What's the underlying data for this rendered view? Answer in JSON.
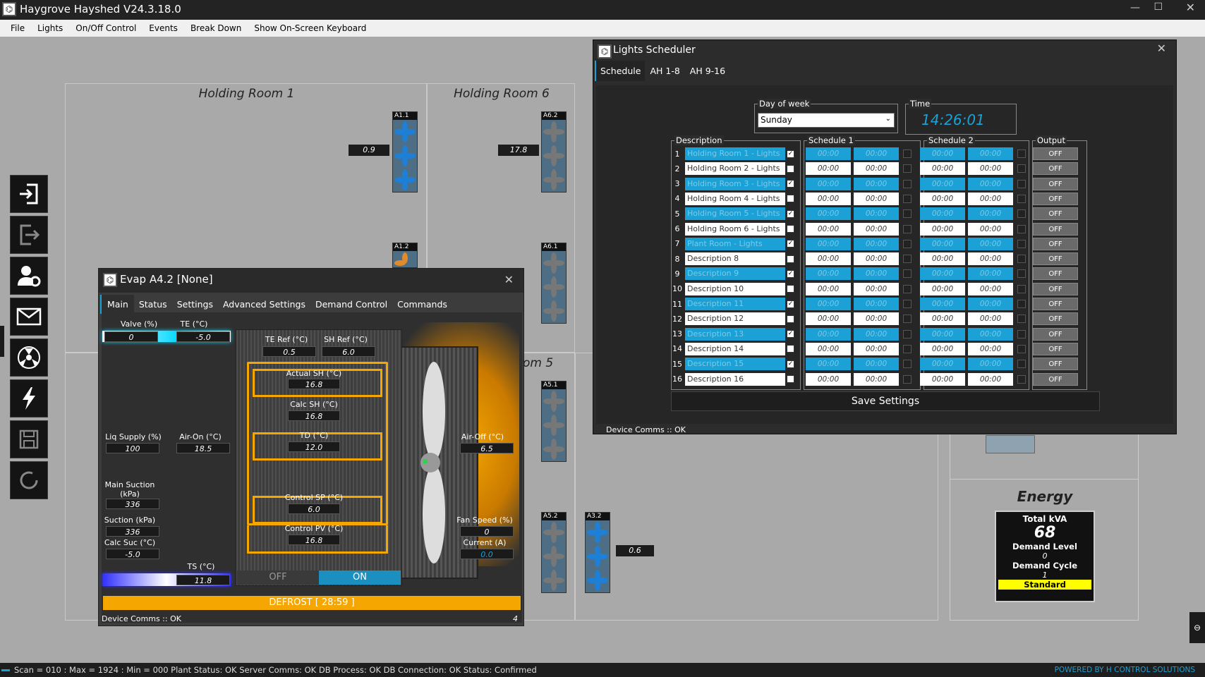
{
  "app": {
    "title": "Haygrove Hayshed V24.3.18.0"
  },
  "menu": [
    "File",
    "Lights",
    "On/Off Control",
    "Events",
    "Break Down",
    "Show On-Screen Keyboard"
  ],
  "rooms": {
    "room1": {
      "title": "Holding Room 1",
      "value": "0.9",
      "fan_top": "A1.1",
      "fan_bottom": "A1.2"
    },
    "room6": {
      "title": "Holding Room 6",
      "value": "17.8",
      "fan_top": "A6.2",
      "fan_bottom": "A6.1"
    },
    "room5": {
      "title_partial": "om 5",
      "fan_a": "A5.1",
      "fan_b": "A5.2",
      "fan_c": "A3.2",
      "value": "0.6"
    }
  },
  "energy": {
    "title": "Energy",
    "total_label": "Total kVA",
    "total_value": "68",
    "demand_level_label": "Demand Level",
    "demand_level_value": "0",
    "demand_cycle_label": "Demand Cycle",
    "demand_cycle_value": "1",
    "mode": "Standard"
  },
  "evap": {
    "title": "Evap A4.2 [None]",
    "tabs": [
      "Main",
      "Status",
      "Settings",
      "Advanced Settings",
      "Demand Control",
      "Commands"
    ],
    "valve_label": "Valve (%)",
    "valve": "0",
    "te_label": "TE (°C)",
    "te": "-5.0",
    "te_ref_label": "TE Ref (°C)",
    "te_ref": "0.5",
    "sh_ref_label": "SH Ref (°C)",
    "sh_ref": "6.0",
    "actual_sh_label": "Actual SH (°C)",
    "actual_sh": "16.8",
    "calc_sh_label": "Calc SH (°C)",
    "calc_sh": "16.8",
    "td_label": "TD (°C)",
    "td": "12.0",
    "control_sp_label": "Control SP (°C)",
    "control_sp": "6.0",
    "control_pv_label": "Control PV (°C)",
    "control_pv": "16.8",
    "liq_supply_label": "Liq Supply (%)",
    "liq_supply": "100",
    "air_on_label": "Air-On (°C)",
    "air_on": "18.5",
    "air_off_label": "Air-Off (°C)",
    "air_off": "6.5",
    "main_suction_label": "Main Suction (kPa)",
    "main_suction": "336",
    "suction_label": "Suction (kPa)",
    "suction": "336",
    "calc_suc_label": "Calc Suc (°C)",
    "calc_suc": "-5.0",
    "ts_label": "TS (°C)",
    "ts": "11.8",
    "fan_speed_label": "Fan Speed (%)",
    "fan_speed": "0",
    "current_label": "Current (A)",
    "current": "0.0",
    "off_label": "OFF",
    "on_label": "ON",
    "defrost": "DEFROST [ 28:59 ]",
    "comms": "Device Comms :: OK",
    "page": "4"
  },
  "lights": {
    "title": "Lights Scheduler",
    "tabs": [
      "Schedule",
      "AH 1-8",
      "AH 9-16"
    ],
    "day_label": "Day of week",
    "day": "Sunday",
    "time_label": "Time",
    "time": "14:26:01",
    "desc_header": "Description",
    "sched1_header": "Schedule 1",
    "sched2_header": "Schedule 2",
    "output_header": "Output",
    "rows": [
      {
        "n": "1",
        "d": "Holding Room 1 - Lights",
        "en": true,
        "s1a": "00:00",
        "s1b": "00:00",
        "s2a": "00:00",
        "s2b": "00:00",
        "out": "OFF"
      },
      {
        "n": "2",
        "d": "Holding Room 2 - Lights",
        "en": false,
        "s1a": "00:00",
        "s1b": "00:00",
        "s2a": "00:00",
        "s2b": "00:00",
        "out": "OFF"
      },
      {
        "n": "3",
        "d": "Holding Room 3 - Lights",
        "en": true,
        "s1a": "00:00",
        "s1b": "00:00",
        "s2a": "00:00",
        "s2b": "00:00",
        "out": "OFF"
      },
      {
        "n": "4",
        "d": "Holding Room 4 - Lights",
        "en": false,
        "s1a": "00:00",
        "s1b": "00:00",
        "s2a": "00:00",
        "s2b": "00:00",
        "out": "OFF"
      },
      {
        "n": "5",
        "d": "Holding Room 5 - Lights",
        "en": true,
        "s1a": "00:00",
        "s1b": "00:00",
        "s2a": "00:00",
        "s2b": "00:00",
        "out": "OFF"
      },
      {
        "n": "6",
        "d": "Holding Room 6 - Lights",
        "en": false,
        "s1a": "00:00",
        "s1b": "00:00",
        "s2a": "00:00",
        "s2b": "00:00",
        "out": "OFF"
      },
      {
        "n": "7",
        "d": "Plant Room - Lights",
        "en": true,
        "s1a": "00:00",
        "s1b": "00:00",
        "s2a": "00:00",
        "s2b": "00:00",
        "out": "OFF"
      },
      {
        "n": "8",
        "d": "Description 8",
        "en": false,
        "s1a": "00:00",
        "s1b": "00:00",
        "s2a": "00:00",
        "s2b": "00:00",
        "out": "OFF"
      },
      {
        "n": "9",
        "d": "Description 9",
        "en": true,
        "s1a": "00:00",
        "s1b": "00:00",
        "s2a": "00:00",
        "s2b": "00:00",
        "out": "OFF"
      },
      {
        "n": "10",
        "d": "Description 10",
        "en": false,
        "s1a": "00:00",
        "s1b": "00:00",
        "s2a": "00:00",
        "s2b": "00:00",
        "out": "OFF"
      },
      {
        "n": "11",
        "d": "Description 11",
        "en": true,
        "s1a": "00:00",
        "s1b": "00:00",
        "s2a": "00:00",
        "s2b": "00:00",
        "out": "OFF"
      },
      {
        "n": "12",
        "d": "Description 12",
        "en": false,
        "s1a": "00:00",
        "s1b": "00:00",
        "s2a": "00:00",
        "s2b": "00:00",
        "out": "OFF"
      },
      {
        "n": "13",
        "d": "Description 13",
        "en": true,
        "s1a": "00:00",
        "s1b": "00:00",
        "s2a": "00:00",
        "s2b": "00:00",
        "out": "OFF"
      },
      {
        "n": "14",
        "d": "Description 14",
        "en": false,
        "s1a": "00:00",
        "s1b": "00:00",
        "s2a": "00:00",
        "s2b": "00:00",
        "out": "OFF"
      },
      {
        "n": "15",
        "d": "Description 15",
        "en": true,
        "s1a": "00:00",
        "s1b": "00:00",
        "s2a": "00:00",
        "s2b": "00:00",
        "out": "OFF"
      },
      {
        "n": "16",
        "d": "Description 16",
        "en": false,
        "s1a": "00:00",
        "s1b": "00:00",
        "s2a": "00:00",
        "s2b": "00:00",
        "out": "OFF"
      }
    ],
    "save": "Save Settings",
    "comms": "Device Comms :: OK"
  },
  "status": {
    "text": "Scan = 010 : Max = 1924 : Min = 000    Plant Status: OK    Server Comms: OK    DB Process:  OK    DB Connection:  OK    Status:  Confirmed",
    "brand": "POWERED BY H CONTROL SOLUTIONS"
  },
  "colors": {
    "accent_cyan": "#1ba1d6",
    "defrost_orange": "#f5a600",
    "on_blue": "#1a8fc0",
    "standard_yellow": "#ffff00"
  }
}
